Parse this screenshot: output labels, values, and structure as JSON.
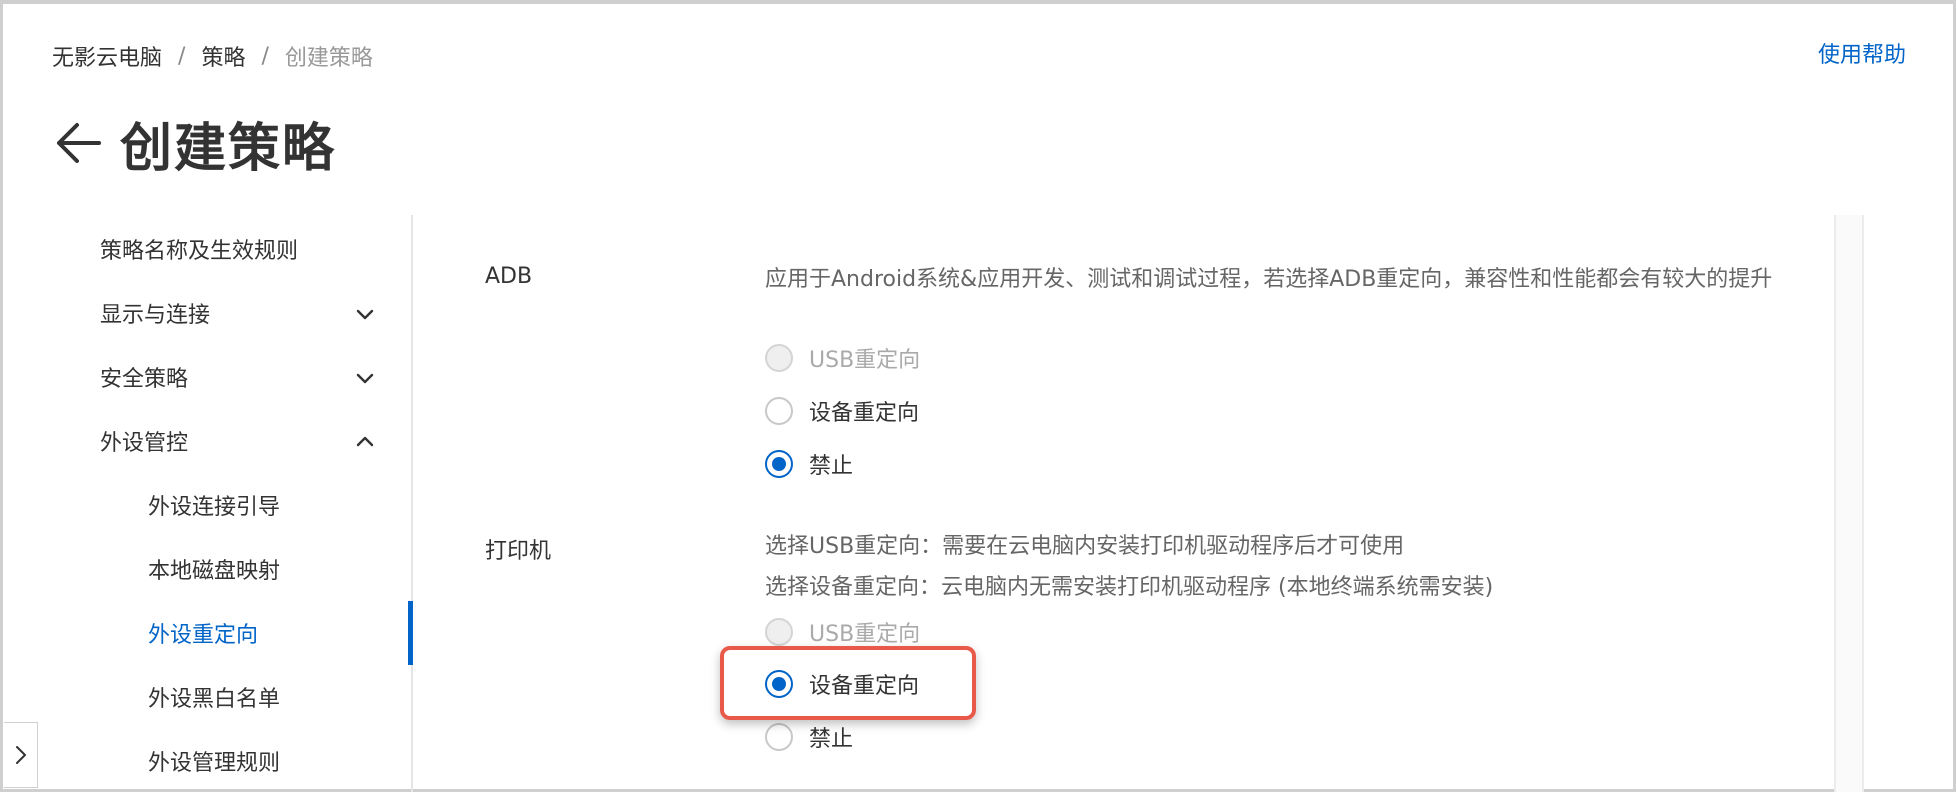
{
  "breadcrumb": {
    "items": [
      "无影云电脑",
      "策略",
      "创建策略"
    ],
    "separator": "/"
  },
  "header": {
    "help_link": "使用帮助",
    "title": "创建策略"
  },
  "sidebar": {
    "items": [
      {
        "label": "策略名称及生效规则"
      },
      {
        "label": "显示与连接",
        "icon": "chevron-down-icon"
      },
      {
        "label": "安全策略",
        "icon": "chevron-down-icon"
      },
      {
        "label": "外设管控",
        "icon": "chevron-up-icon"
      },
      {
        "label": "外设连接引导"
      },
      {
        "label": "本地磁盘映射"
      },
      {
        "label": "外设重定向",
        "active": true
      },
      {
        "label": "外设黑白名单"
      },
      {
        "label": "外设管理规则"
      }
    ]
  },
  "settings": {
    "adb": {
      "label": "ADB",
      "description": "应用于Android系统&应用开发、测试和调试过程，若选择ADB重定向，兼容性和性能都会有较大的提升",
      "options": [
        {
          "label": "USB重定向",
          "state": "disabled"
        },
        {
          "label": "设备重定向",
          "state": "unchecked"
        },
        {
          "label": "禁止",
          "state": "checked"
        }
      ]
    },
    "printer": {
      "label": "打印机",
      "description_1": "选择USB重定向：需要在云电脑内安装打印机驱动程序后才可使用",
      "description_2": "选择设备重定向：云电脑内无需安装打印机驱动程序 (本地终端系统需安装)",
      "options": [
        {
          "label": "USB重定向",
          "state": "disabled"
        },
        {
          "label": "设备重定向",
          "state": "checked"
        },
        {
          "label": "禁止",
          "state": "unchecked"
        }
      ]
    }
  },
  "colors": {
    "accent": "#0064c8",
    "highlight": "#e8594a"
  }
}
